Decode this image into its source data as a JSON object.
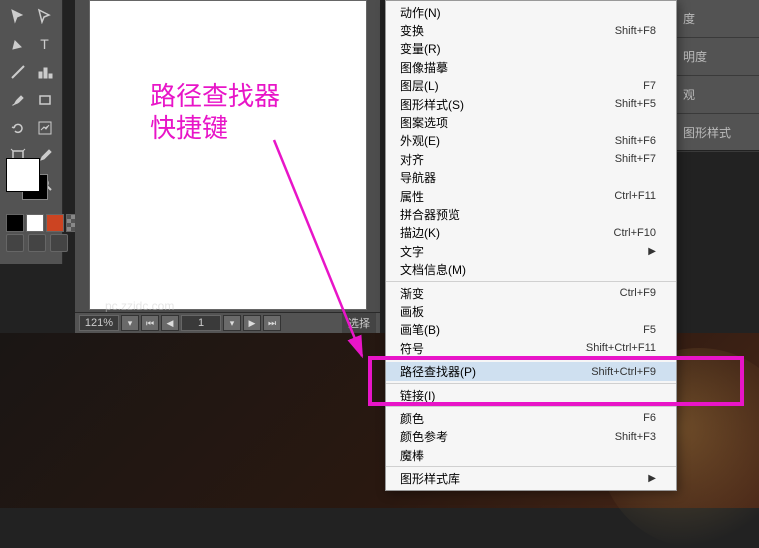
{
  "annotation": {
    "line1": "路径查找器",
    "line2": "快捷键"
  },
  "zoom": {
    "pct": "121%",
    "page": "1",
    "sel": "选择"
  },
  "watermark": "pc.zzidc.com",
  "rpanel": [
    "度",
    "明度",
    "观",
    "图形样式"
  ],
  "menu": [
    {
      "t": "item",
      "label": "动作(N)",
      "sc": ""
    },
    {
      "t": "item",
      "label": "变换",
      "sc": "Shift+F8"
    },
    {
      "t": "item",
      "label": "变量(R)",
      "sc": ""
    },
    {
      "t": "item",
      "label": "图像描摹",
      "sc": ""
    },
    {
      "t": "item",
      "label": "图层(L)",
      "sc": "F7"
    },
    {
      "t": "item",
      "label": "图形样式(S)",
      "sc": "Shift+F5"
    },
    {
      "t": "item",
      "label": "图案选项",
      "sc": ""
    },
    {
      "t": "item",
      "label": "外观(E)",
      "sc": "Shift+F6"
    },
    {
      "t": "item",
      "label": "对齐",
      "sc": "Shift+F7"
    },
    {
      "t": "item",
      "label": "导航器",
      "sc": ""
    },
    {
      "t": "item",
      "label": "属性",
      "sc": "Ctrl+F11"
    },
    {
      "t": "item",
      "label": "拼合器预览",
      "sc": ""
    },
    {
      "t": "item",
      "label": "描边(K)",
      "sc": "Ctrl+F10"
    },
    {
      "t": "item",
      "label": "文字",
      "sc": "",
      "sub": true
    },
    {
      "t": "item",
      "label": "文档信息(M)",
      "sc": ""
    },
    {
      "t": "sep"
    },
    {
      "t": "item",
      "label": "渐变",
      "sc": "Ctrl+F9"
    },
    {
      "t": "item",
      "label": "画板",
      "sc": ""
    },
    {
      "t": "item",
      "label": "画笔(B)",
      "sc": "F5"
    },
    {
      "t": "item",
      "label": "符号",
      "sc": "Shift+Ctrl+F11"
    },
    {
      "t": "sep"
    },
    {
      "t": "item",
      "label": "路径查找器(P)",
      "sc": "Shift+Ctrl+F9",
      "hl": true
    },
    {
      "t": "sep"
    },
    {
      "t": "item",
      "label": "链接(I)",
      "sc": ""
    },
    {
      "t": "sep"
    },
    {
      "t": "item",
      "label": "颜色",
      "sc": "F6"
    },
    {
      "t": "item",
      "label": "颜色参考",
      "sc": "Shift+F3"
    },
    {
      "t": "item",
      "label": "魔棒",
      "sc": ""
    },
    {
      "t": "sep"
    },
    {
      "t": "item",
      "label": "图形样式库",
      "sc": "",
      "sub": true
    }
  ]
}
